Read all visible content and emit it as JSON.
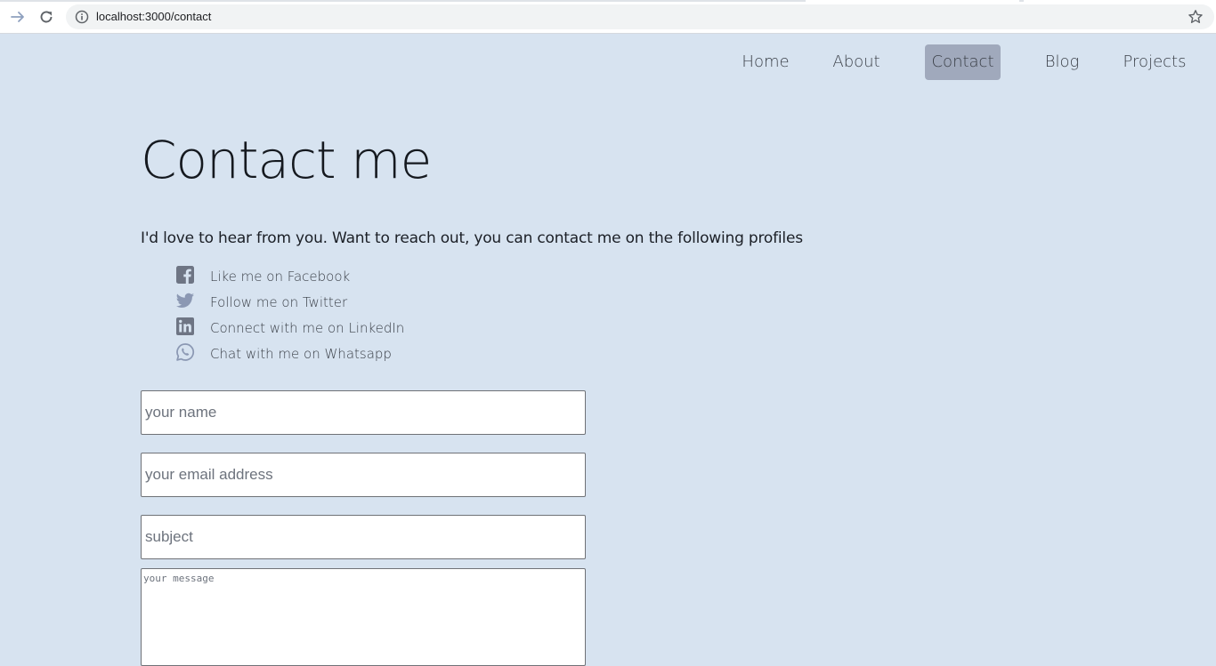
{
  "browser": {
    "url": "localhost:3000/contact",
    "icons": {
      "forward": "arrow-right-icon",
      "reload": "reload-icon",
      "info": "info-icon",
      "bookmark": "star-icon"
    }
  },
  "nav": {
    "items": [
      {
        "label": "Home",
        "active": false
      },
      {
        "label": "About",
        "active": false
      },
      {
        "label": "Contact",
        "active": true
      },
      {
        "label": "Blog",
        "active": false
      },
      {
        "label": "Projects",
        "active": false
      }
    ]
  },
  "page": {
    "title": "Contact me",
    "intro": "I'd love to hear from you. Want to reach out, you can contact me on the following profiles",
    "profiles": [
      {
        "label": "Like me on Facebook",
        "icon": "facebook-icon"
      },
      {
        "label": "Follow me on Twitter",
        "icon": "twitter-icon"
      },
      {
        "label": "Connect with me on LinkedIn",
        "icon": "linkedin-icon"
      },
      {
        "label": "Chat with me on Whatsapp",
        "icon": "whatsapp-icon"
      }
    ]
  },
  "form": {
    "name_placeholder": "your name",
    "email_placeholder": "your email address",
    "subject_placeholder": "subject",
    "message_placeholder": "your message"
  },
  "colors": {
    "background": "#d7e3f0",
    "nav_active_bg": "#a0a9bc",
    "text": "#3a3f47",
    "icon": "#6e7584"
  }
}
